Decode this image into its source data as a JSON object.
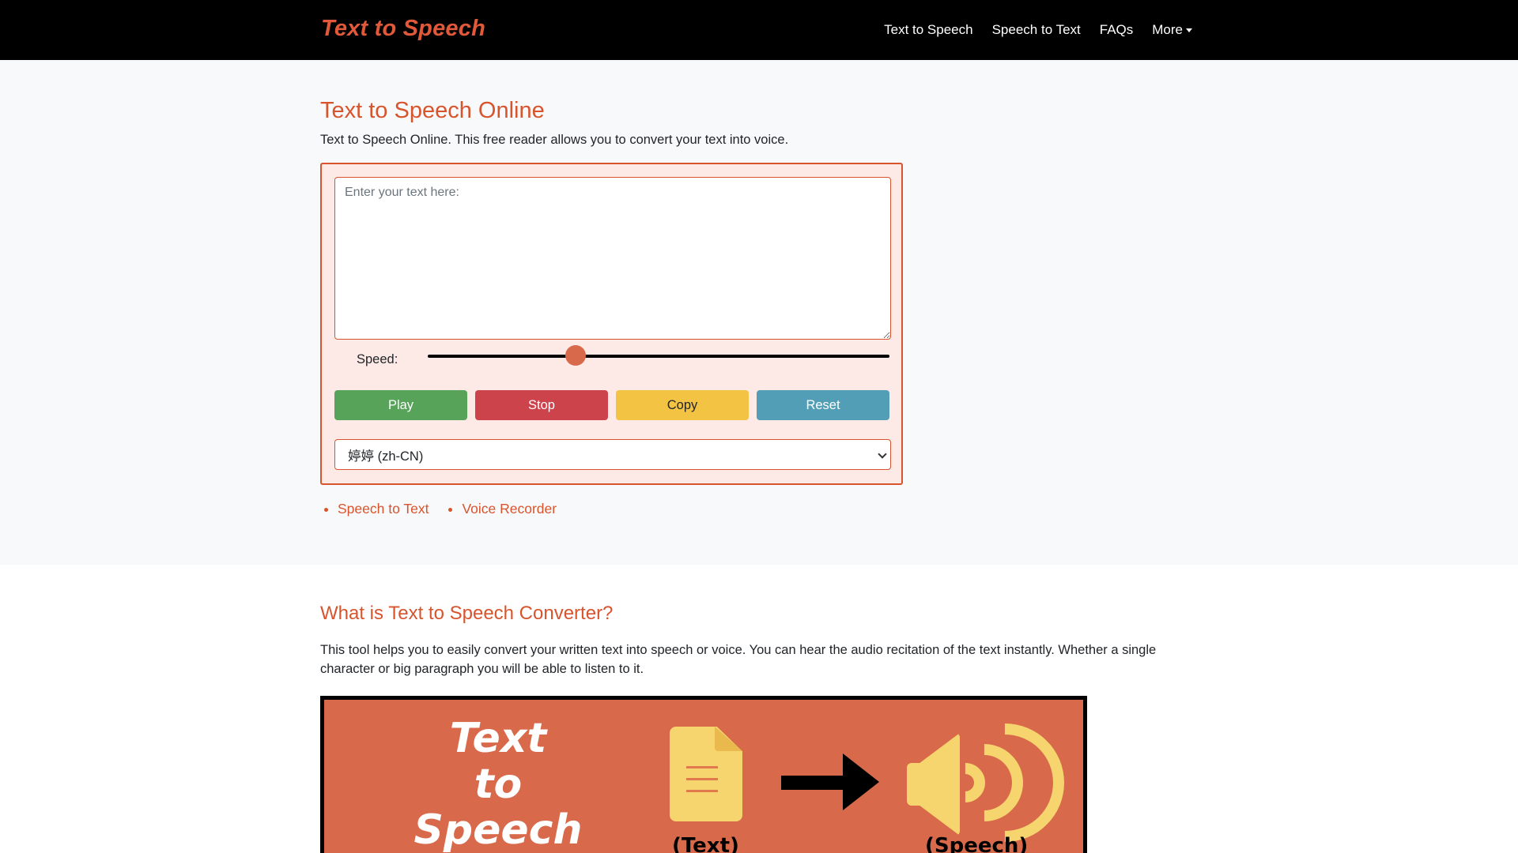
{
  "navbar": {
    "brand": "Text to Speech",
    "links": [
      "Text to Speech",
      "Speech to Text",
      "FAQs",
      "More"
    ]
  },
  "hero": {
    "title": "Text to Speech Online",
    "lead": "Text to Speech Online. This free reader allows you to convert your text into voice.",
    "textarea_placeholder": "Enter your text here:",
    "speed_label": "Speed:",
    "speed_value": 0.32,
    "buttons": {
      "play": "Play",
      "stop": "Stop",
      "copy": "Copy",
      "reset": "Reset"
    },
    "voice_select": "婷婷 (zh-CN)",
    "links": [
      "Speech to Text",
      "Voice Recorder"
    ]
  },
  "section": {
    "title": "What is Text to Speech Converter?",
    "body": "This tool helps you to easily convert your written text into speech or voice. You can hear the audio recitation of the text instantly. Whether a single character or big paragraph you will be able to listen to it."
  },
  "banner": {
    "title_lines": [
      "Text",
      "to",
      "Speech"
    ],
    "caption_text": "(Text)",
    "caption_speech": "(Speech)"
  },
  "colors": {
    "accent": "#d8542d",
    "play": "#57a35a",
    "stop": "#cc434c",
    "copy": "#f3c344",
    "reset": "#529eb6",
    "banner_bg": "#d86a4b"
  },
  "icons": [
    "caret-down-icon",
    "document-icon",
    "arrow-right-icon",
    "speaker-icon",
    "chevron-down-icon"
  ]
}
